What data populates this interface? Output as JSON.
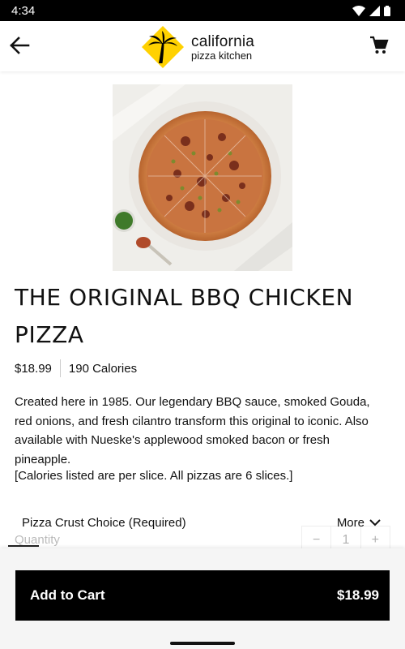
{
  "status_bar": {
    "time": "4:34"
  },
  "header": {
    "brand_line1": "california",
    "brand_line2": "pizza kitchen",
    "back_icon": "arrow-left-icon",
    "cart_icon": "shopping-cart-icon"
  },
  "product": {
    "title": "THE ORIGINAL BBQ CHICKEN PIZZA",
    "price": "$18.99",
    "calories": "190 Calories",
    "description": "Created here in 1985. Our legendary BBQ sauce, smoked Gouda, red onions, and fresh cilantro transform this original to iconic. Also available with Nueske's applewood smoked bacon or fresh pineapple.",
    "note": "[Calories listed are per slice. All pizzas are 6 slices.]"
  },
  "options": {
    "crust_label": "Pizza Crust Choice (Required)",
    "more_label": "More",
    "quantity_label": "Quantity",
    "stepper_minus": "−",
    "stepper_value": "1",
    "stepper_plus": "+"
  },
  "cart_button": {
    "label": "Add to Cart",
    "price": "$18.99"
  },
  "colors": {
    "brand_yellow": "#FFD100",
    "button_black": "#000000"
  }
}
